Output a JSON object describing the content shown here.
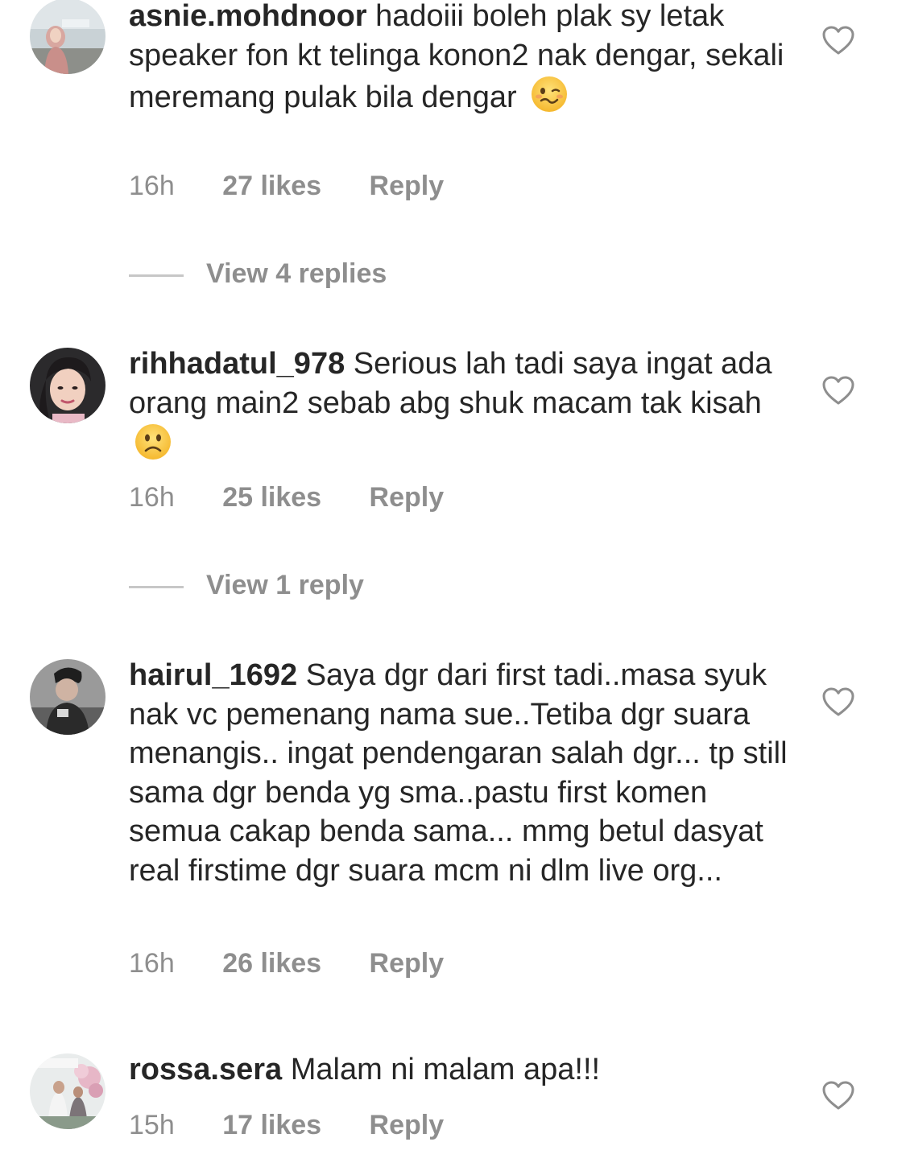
{
  "comments": [
    {
      "username": "asnie.mohdnoor",
      "text": "hadoiii boleh plak sy letak speaker fon kt telinga konon2 nak dengar, sekali meremang pulak bila dengar",
      "emoji": "woozy-face",
      "time": "16h",
      "likes": "27 likes",
      "reply": "Reply",
      "view_replies": "View 4 replies"
    },
    {
      "username": "rihhadatul_978",
      "text": "Serious lah tadi saya ingat ada orang main2 sebab abg shuk macam tak kisah",
      "emoji": "slightly-frowning-face",
      "time": "16h",
      "likes": "25 likes",
      "reply": "Reply",
      "view_replies": "View 1 reply"
    },
    {
      "username": "hairul_1692",
      "text": "Saya dgr dari first tadi..masa syuk nak vc pemenang nama sue..Tetiba dgr suara menangis.. ingat pendengaran salah dgr... tp still sama dgr benda yg sma..pastu first komen semua cakap benda sama... mmg betul dasyat real firstime dgr suara mcm ni dlm live org...",
      "time": "16h",
      "likes": "26 likes",
      "reply": "Reply"
    },
    {
      "username": "rossa.sera",
      "text": "Malam ni malam apa!!!",
      "time": "15h",
      "likes": "17 likes",
      "reply": "Reply"
    }
  ],
  "icons": {
    "like": "heart-outline-icon"
  },
  "colors": {
    "text": "#262626",
    "secondary": "#8e8e8e",
    "divider": "#c7c7c7"
  }
}
